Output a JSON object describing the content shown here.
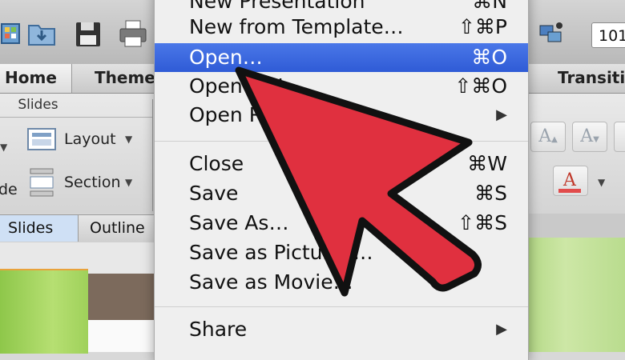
{
  "toolbar": {
    "zoom_value": "101",
    "icons": [
      "gallery-icon",
      "open-folder-icon",
      "save-icon",
      "print-icon",
      "media-browser-icon"
    ]
  },
  "ribbon": {
    "tabs": {
      "home": "Home",
      "themes": "Theme",
      "transitions": "Transiti"
    },
    "group_title": "Slides",
    "layout_label": "Layout",
    "section_label": "Section",
    "new_slide_partial": "de"
  },
  "pane": {
    "slides_tab": "Slides",
    "outline_tab": "Outline"
  },
  "menu": {
    "items": [
      {
        "label": "New Presentation",
        "shortcut": "⌘N"
      },
      {
        "label": "New from Template…",
        "shortcut": "⇧⌘P"
      },
      {
        "label": "Open…",
        "shortcut": "⌘O",
        "highlighted": true
      },
      {
        "label": "Open URL…",
        "shortcut": "⇧⌘O"
      },
      {
        "label": "Open Recent",
        "submenu": true
      },
      {
        "label": "Close",
        "shortcut": "⌘W"
      },
      {
        "label": "Save",
        "shortcut": "⌘S"
      },
      {
        "label": "Save As…",
        "shortcut": "⇧⌘S"
      },
      {
        "label": "Save as Pictures…"
      },
      {
        "label": "Save as Movie…"
      },
      {
        "label": "Share",
        "submenu": true
      }
    ]
  },
  "colors": {
    "menu_highlight": "#2f5bd6",
    "annotation_arrow_fill": "#e0303f",
    "annotation_arrow_stroke": "#111111"
  }
}
